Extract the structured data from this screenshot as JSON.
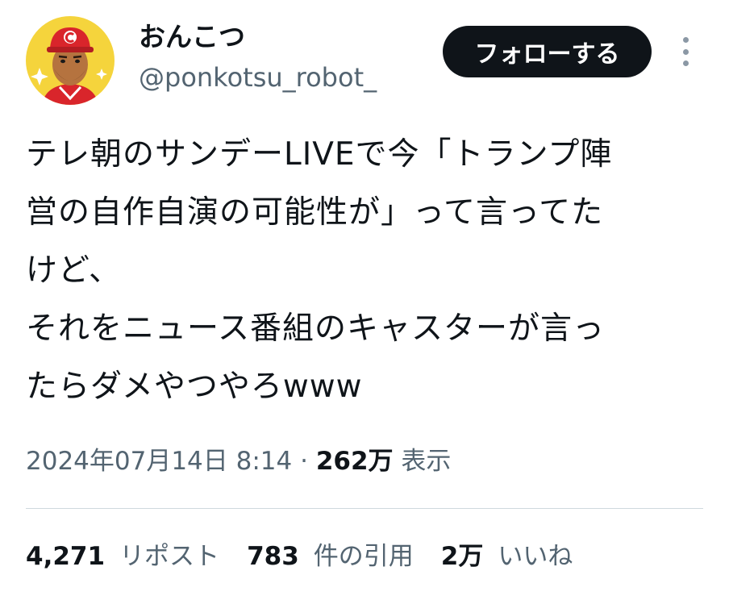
{
  "author": {
    "display_name": "おんこつ",
    "handle": "@ponkotsu_robot_",
    "avatar_icon": "avatar-robot-icon"
  },
  "follow_button_label": "フォローする",
  "more_icon": "more-vertical-icon",
  "tweet": {
    "lines": [
      "テレ朝のサンデーLIVEで今「トランプ陣",
      "営の自作自演の可能性が」って言ってた",
      "けど、",
      "それをニュース番組のキャスターが言っ",
      "たらダメやつやろwww"
    ]
  },
  "meta": {
    "timestamp": "2024年07月14日 8:14",
    "separator": " · ",
    "views_count": "262万",
    "views_label": "表示"
  },
  "stats": {
    "reposts_count": "4,271",
    "reposts_label": "リポスト",
    "quotes_count": "783",
    "quotes_label": "件の引用",
    "likes_count": "2万",
    "likes_label": "いいね"
  },
  "colors": {
    "text": "#0f1419",
    "secondary": "#536471",
    "button_bg": "#0f1419",
    "avatar_bg": "#f5d43c",
    "avatar_cap": "#d9252b"
  }
}
